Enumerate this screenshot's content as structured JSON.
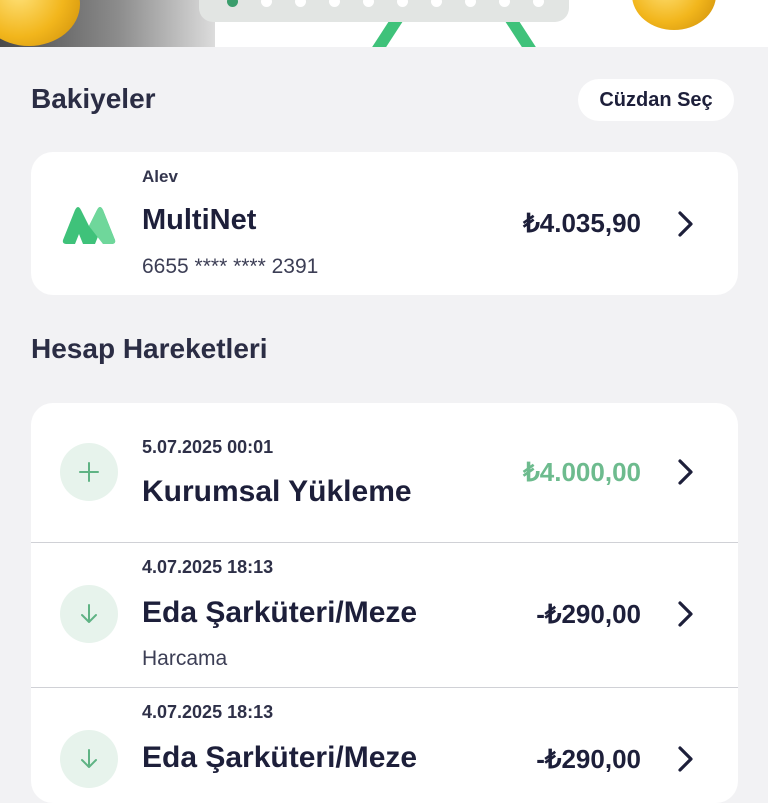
{
  "header": {
    "title": "Bakiyeler",
    "wallet_button": "Cüzdan Seç"
  },
  "card": {
    "owner": "Alev",
    "name": "MultiNet",
    "number": "6655 **** **** 2391",
    "balance": "₺4.035,90",
    "logo_icon": "multinet-logo-icon",
    "accent": "#3fc27a"
  },
  "transactions_title": "Hesap Hareketleri",
  "transactions": [
    {
      "date": "5.07.2025 00:01",
      "title": "Kurumsal Yükleme",
      "subtitle": "",
      "amount": "₺4.000,00",
      "icon": "plus-icon",
      "type": "credit"
    },
    {
      "date": "4.07.2025 18:13",
      "title": "Eda Şarküteri/Meze",
      "subtitle": "Harcama",
      "amount": "-₺290,00",
      "icon": "arrow-down-icon",
      "type": "debit"
    },
    {
      "date": "4.07.2025 18:13",
      "title": "Eda Şarküteri/Meze",
      "subtitle": "",
      "amount": "-₺290,00",
      "icon": "arrow-down-icon",
      "type": "debit"
    }
  ],
  "colors": {
    "positive_amount": "#6dbb8e",
    "icon_circle": "#e7f3ec",
    "icon_stroke": "#5fb384",
    "background": "#f2f2f4"
  }
}
